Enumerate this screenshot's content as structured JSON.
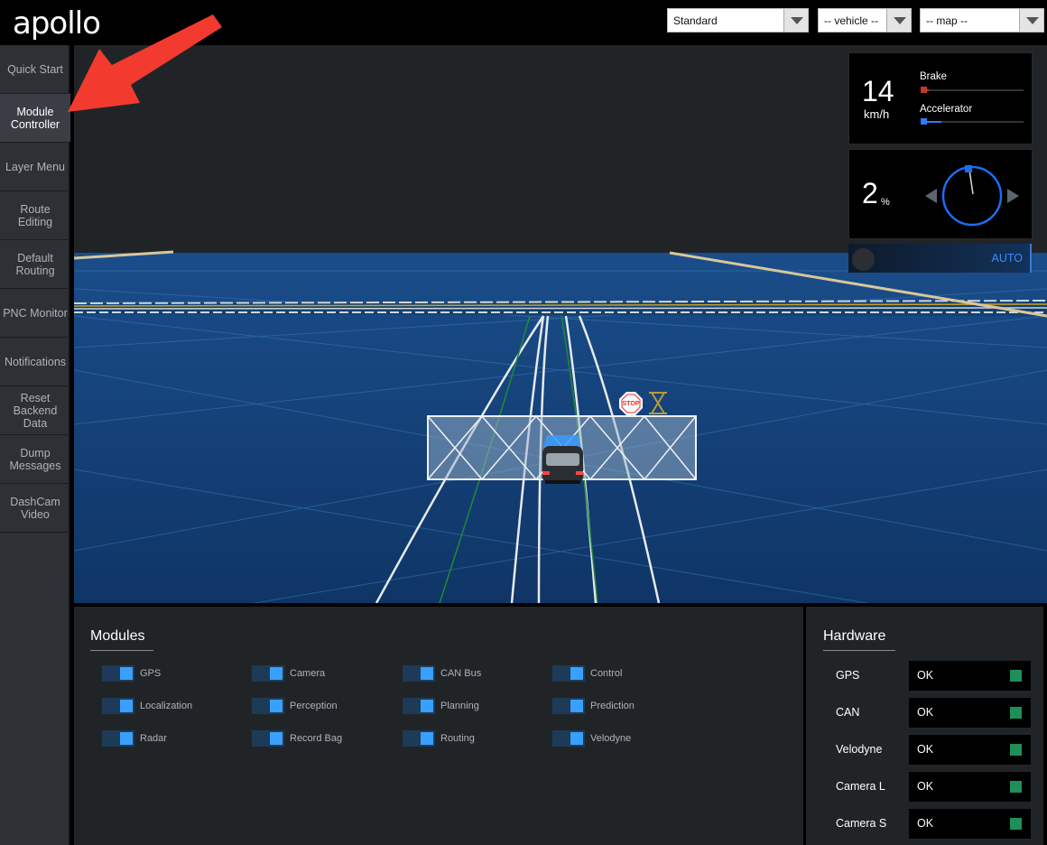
{
  "header": {
    "logo": "apollo",
    "mode_select": "Standard",
    "vehicle_select": "-- vehicle --",
    "map_select": "-- map --"
  },
  "sidebar": {
    "items": [
      {
        "label": "Quick Start",
        "active": false
      },
      {
        "label": "Module Controller",
        "active": true
      },
      {
        "label": "Layer Menu",
        "active": false
      },
      {
        "label": "Route Editing",
        "active": false
      },
      {
        "label": "Default Routing",
        "active": false
      },
      {
        "label": "PNC Monitor",
        "active": false
      },
      {
        "label": "Notifications",
        "active": false
      },
      {
        "label": "Reset Backend Data",
        "active": false
      },
      {
        "label": "Dump Messages",
        "active": false
      },
      {
        "label": "DashCam Video",
        "active": false
      }
    ]
  },
  "dashboard": {
    "speed": "14",
    "speed_unit": "km/h",
    "brake_label": "Brake",
    "brake_level": 0.08,
    "accelerator_label": "Accelerator",
    "accelerator_level": 0.2,
    "steering": "2",
    "steering_unit": "%",
    "drive_mode": "AUTO"
  },
  "scene": {
    "stop_sign": "STOP"
  },
  "modules": {
    "title": "Modules",
    "items": [
      {
        "label": "GPS",
        "on": true
      },
      {
        "label": "Camera",
        "on": true
      },
      {
        "label": "CAN Bus",
        "on": true
      },
      {
        "label": "Control",
        "on": true
      },
      {
        "label": "Localization",
        "on": true
      },
      {
        "label": "Perception",
        "on": true
      },
      {
        "label": "Planning",
        "on": true
      },
      {
        "label": "Prediction",
        "on": true
      },
      {
        "label": "Radar",
        "on": true
      },
      {
        "label": "Record Bag",
        "on": true
      },
      {
        "label": "Routing",
        "on": true
      },
      {
        "label": "Velodyne",
        "on": true
      }
    ]
  },
  "hardware": {
    "title": "Hardware",
    "items": [
      {
        "name": "GPS",
        "status": "OK"
      },
      {
        "name": "CAN",
        "status": "OK"
      },
      {
        "name": "Velodyne",
        "status": "OK"
      },
      {
        "name": "Camera L",
        "status": "OK"
      },
      {
        "name": "Camera S",
        "status": "OK"
      }
    ]
  },
  "colors": {
    "accent": "#3aa0ff",
    "brake": "#c0392b",
    "accelerator": "#2f7cf6",
    "status_ok": "#1f8f5a",
    "annotation_arrow": "#f23a2f"
  }
}
